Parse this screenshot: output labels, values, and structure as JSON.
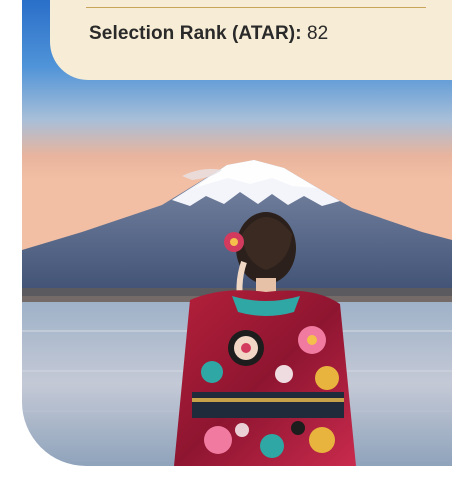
{
  "info_card": {
    "selection_rank_label": "Selection Rank (ATAR)",
    "selection_rank_separator": ":",
    "selection_rank_value": " 82"
  },
  "photo": {
    "alt": "Woman in a floral kimono facing Mount Fuji across a lake"
  },
  "colors": {
    "card_background": "#f7ecd5",
    "card_divider": "#c9a45b",
    "text": "#2a2a2a"
  }
}
